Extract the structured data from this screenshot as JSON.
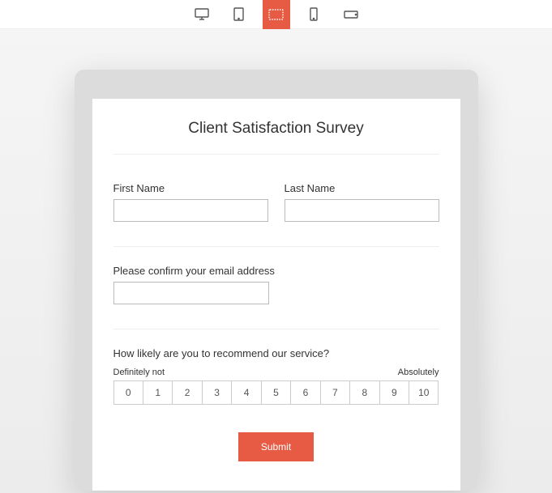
{
  "accent_color": "#e75a43",
  "toolbar": {
    "devices": [
      {
        "name": "desktop",
        "active": false
      },
      {
        "name": "tablet-portrait",
        "active": false
      },
      {
        "name": "tablet-landscape",
        "active": true
      },
      {
        "name": "phone-portrait",
        "active": false
      },
      {
        "name": "phone-landscape",
        "active": false
      }
    ]
  },
  "form": {
    "title": "Client Satisfaction Survey",
    "first_name_label": "First Name",
    "last_name_label": "Last Name",
    "email_label": "Please confirm your email address",
    "recommend_label": "How likely are you to recommend our service?",
    "scale_low_label": "Definitely not",
    "scale_high_label": "Absolutely",
    "scale_values": [
      "0",
      "1",
      "2",
      "3",
      "4",
      "5",
      "6",
      "7",
      "8",
      "9",
      "10"
    ],
    "submit_label": "Submit"
  }
}
